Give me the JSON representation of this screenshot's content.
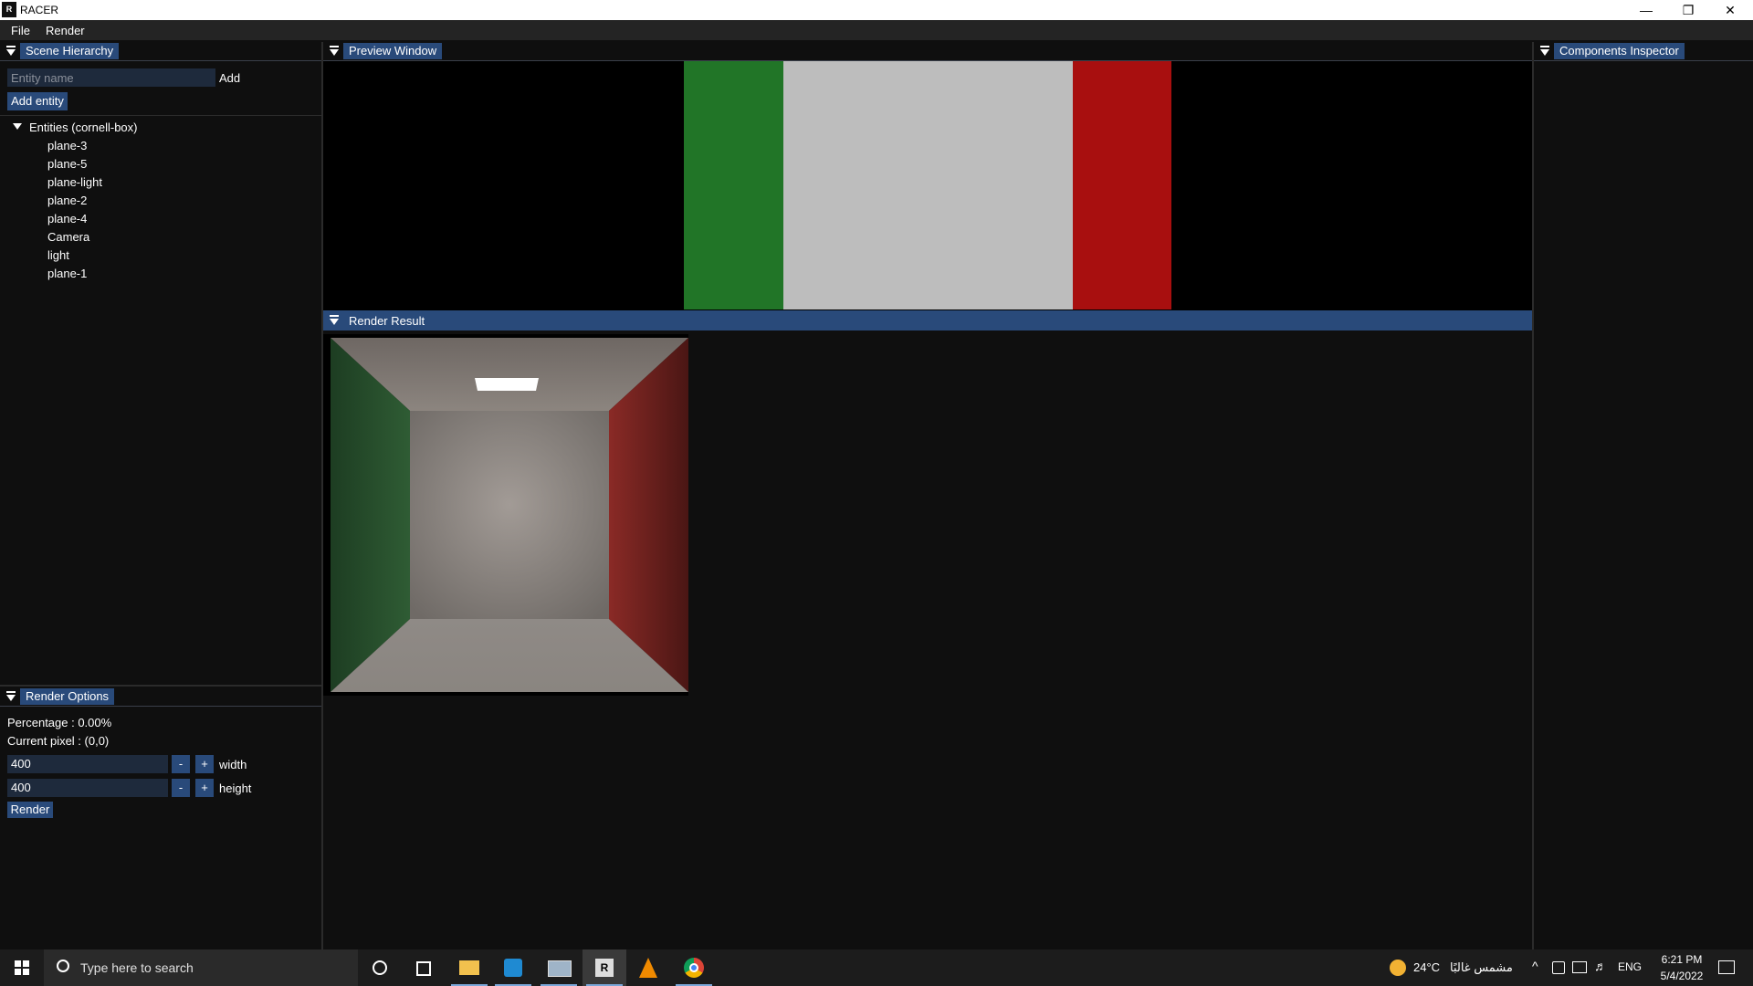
{
  "window": {
    "title": "RACER",
    "app_icon_text": "R"
  },
  "menu": {
    "file": "File",
    "render": "Render"
  },
  "scene_hierarchy": {
    "title": "Scene Hierarchy",
    "entity_placeholder": "Entity name",
    "add_label": "Add",
    "add_entity_label": "Add entity",
    "tree_root": "Entities (cornell-box)",
    "items": [
      "plane-3",
      "plane-5",
      "plane-light",
      "plane-2",
      "plane-4",
      "Camera",
      "light",
      "plane-1"
    ]
  },
  "preview": {
    "title": "Preview Window"
  },
  "render_result": {
    "title": "Render Result"
  },
  "inspector": {
    "title": "Components Inspector"
  },
  "render_options": {
    "title": "Render Options",
    "percentage": "Percentage : 0.00%",
    "current_pixel": "Current pixel : (0,0)",
    "width_value": "400",
    "height_value": "400",
    "minus": "-",
    "plus": "+",
    "width_label": "width",
    "height_label": "height",
    "render_label": "Render"
  },
  "taskbar": {
    "search_placeholder": "Type here to search",
    "weather_temp": "24°C",
    "weather_text": "مشمس غالبًا",
    "language": "ENG",
    "time": "6:21 PM",
    "date": "5/4/2022"
  },
  "colors": {
    "accent": "#294a7a",
    "green_wall": "#217527",
    "gray_wall": "#bdbdbd",
    "red_wall": "#a80f0f"
  }
}
